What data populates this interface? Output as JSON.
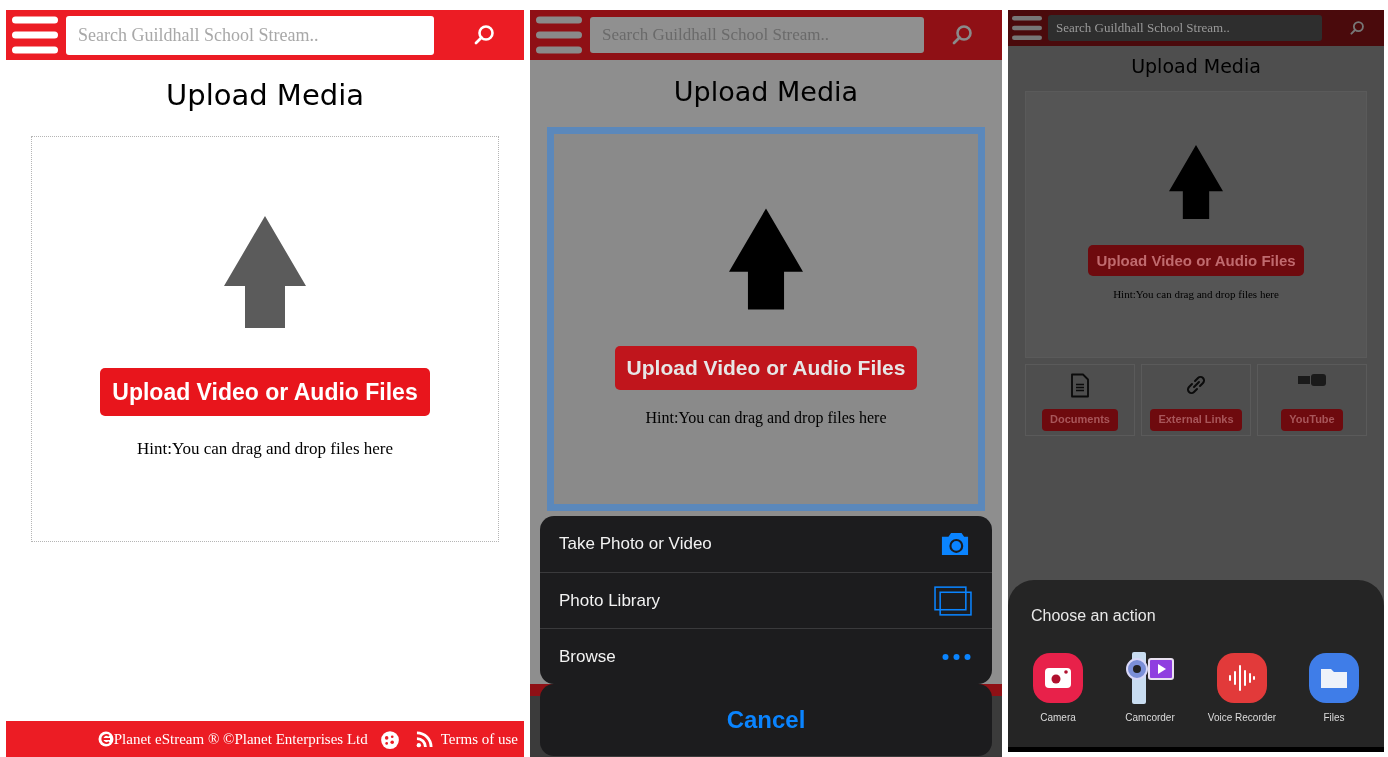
{
  "panels": [
    {
      "kind": "plain",
      "focused": false,
      "search": {
        "placeholder": "Search Guildhall School Stream.."
      },
      "title": "Upload Media",
      "upload_button": "Upload Video or Audio Files",
      "hint": "Hint:You can drag and drop files here",
      "footer": {
        "obscured": false,
        "copyright": "Planet eStream ® ©Planet Enterprises Ltd",
        "terms_link": "Terms of use"
      }
    },
    {
      "kind": "grey",
      "focused": true,
      "search": {
        "placeholder": "Search Guildhall School Stream.."
      },
      "title": "Upload Media",
      "upload_button": "Upload Video or Audio Files",
      "hint": "Hint:You can drag and drop files here",
      "footer": {
        "obscured": true
      },
      "action_sheet": {
        "items": [
          {
            "label": "Take Photo or Video",
            "kind": "camera"
          },
          {
            "label": "Photo Library",
            "kind": "library"
          },
          {
            "label": "Browse",
            "kind": "more"
          }
        ],
        "cancel": "Cancel"
      }
    },
    {
      "kind": "dark",
      "focused": false,
      "search": {
        "placeholder": "Search Guildhall School Stream.."
      },
      "title": "Upload Media",
      "upload_button": "Upload Video or Audio Files",
      "hint": "Hint:You can drag and drop files here",
      "sources": [
        {
          "label": "Documents",
          "kind": "document"
        },
        {
          "label": "External Links",
          "kind": "link"
        },
        {
          "label": "YouTube",
          "kind": "youtube"
        }
      ],
      "chooser": {
        "title": "Choose an action",
        "apps": [
          {
            "label": "Camera",
            "kind": "camera"
          },
          {
            "label": "Camcorder",
            "kind": "camcorder"
          },
          {
            "label": "Voice Recorder",
            "kind": "recorder"
          },
          {
            "label": "Files",
            "kind": "files"
          }
        ]
      }
    }
  ]
}
